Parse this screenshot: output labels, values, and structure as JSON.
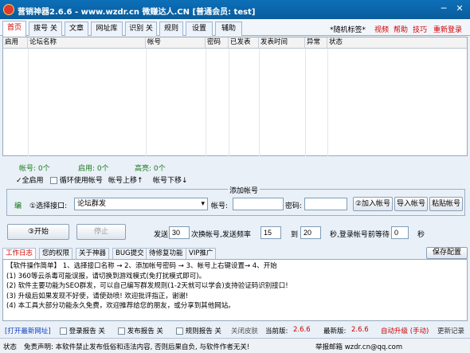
{
  "window": {
    "title": "营销神器2.6.6 - www.wzdr.cn 微赚达人.CN [普通会员: test]",
    "minimize_glyph": "─",
    "close_glyph": "✕"
  },
  "tabs": [
    "首页",
    "拨号 关",
    "文章",
    "网址库",
    "识别 关",
    "规则",
    "设置",
    "辅助"
  ],
  "top_links": {
    "random_tag": "*随机标签*",
    "video": "视频",
    "help": "帮助",
    "tips": "技巧",
    "relogin": "重新登录"
  },
  "grid": {
    "columns": [
      "启用",
      "论坛名称",
      "帐号",
      "密码",
      "已发表",
      "发表时间",
      "异常",
      "状态"
    ]
  },
  "stats": {
    "accounts": "帐号: 0个",
    "enabled": "启用: 0个",
    "highrisk": "高亮: 0个"
  },
  "options": {
    "enable_all": "全启用",
    "loop_accounts": "循环使用帐号",
    "account_up": "帐号上移↑",
    "account_down": "帐号下移↓"
  },
  "add_account": {
    "group_title": "添加帐号",
    "edit_label": "编",
    "select_interface_label": "①选择接口:",
    "interface_value": "论坛群发",
    "account_label": "帐号:",
    "account_value": "",
    "password_label": "密码:",
    "password_value": "",
    "add_button": "②加入帐号",
    "import_button": "导入帐号",
    "paste_button": "粘贴帐号"
  },
  "controls": {
    "start_button": "③开始",
    "stop_button": "停止",
    "send_label": "发送",
    "send_value": "30",
    "switch_label": "次换帐号,发送频率",
    "freq_from": "15",
    "to_label": "到",
    "freq_to": "20",
    "login_wait_label": "秒,登录帐号前等待",
    "wait_value": "0",
    "seconds_label": "秒"
  },
  "log_tabs": [
    "工作日志",
    "您的权限",
    "关于神器",
    "BUG提交",
    "待修复功能",
    "VIP推广"
  ],
  "save_config_button": "保存配置",
  "log_lines": [
    "【软件操作简单】 1、选择接口名称 → 2、添加帐号密码 → 3、帐号上右键设置→ 4、开始",
    "(1) 360等云杀毒可能误报，请切换到游戏模式(免打扰模式即可)。",
    "(2) 软件主要功能为SEO群发，可以自己编写群发规则(1-2天就可以学会)支持验证码识别接口!",
    "(3) 升级后如果发现不好使，请使劲喷! 欢迎批评指正，谢谢!",
    "(4) 本工具大部分功能永久免费，欢迎推荐给您的朋友，或分享到其他网站。"
  ],
  "bottom_bar": {
    "open_site": "[打开最新网址]",
    "login_report": "登录报告 关",
    "post_report": "发布报告 关",
    "rule_report": "规则报告 关",
    "close_skin": "关闭皮肤",
    "current_version_label": "当前版:",
    "current_version": "2.6.6",
    "latest_version_label": "最新版:",
    "latest_version": "2.6.6",
    "auto_upgrade": "自动升级 (手动)",
    "update_log": "更新记录"
  },
  "status_bar": {
    "status_label": "状态",
    "disclaimer": "免责声明: 本软件禁止发布低俗和违法内容, 否则后果自负, 与软件作者无关!",
    "report_email": "举报邮箱 wzdr.cn@qq.com"
  },
  "colors": {
    "titlebar": "#0c6fb8",
    "accent_red": "#d00000",
    "link_blue": "#1040c0",
    "stat_green": "#1a7a1a"
  }
}
